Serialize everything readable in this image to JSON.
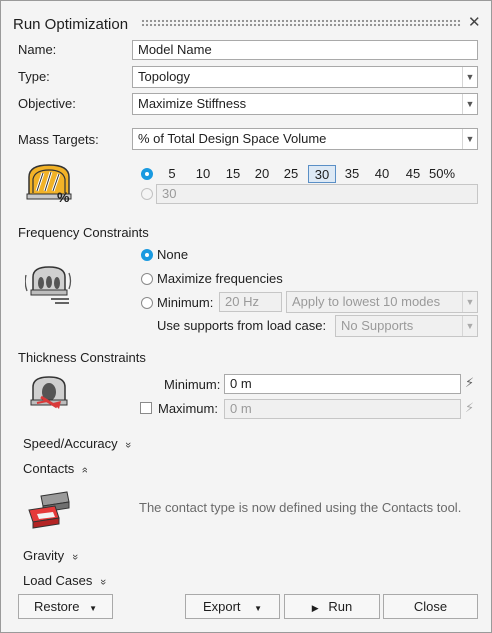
{
  "window": {
    "title": "Run Optimization",
    "close_glyph": "✕"
  },
  "fields": {
    "name_label": "Name:",
    "name_value": "Model Name",
    "type_label": "Type:",
    "type_value": "Topology",
    "objective_label": "Objective:",
    "objective_value": "Maximize Stiffness"
  },
  "mass": {
    "label": "Mass Targets:",
    "mode_value": "% of Total Design Space Volume",
    "percent_options": [
      "5",
      "10",
      "15",
      "20",
      "25",
      "30",
      "35",
      "40",
      "45",
      "50%"
    ],
    "selected_percent": "30",
    "custom_value": "30",
    "icon_pct": "%"
  },
  "frequency": {
    "section_title": "Frequency Constraints",
    "opt_none": "None",
    "opt_maximize": "Maximize frequencies",
    "opt_minimum": "Minimum:",
    "min_value": "20 Hz",
    "apply_value": "Apply to lowest 10 modes",
    "supports_label": "Use supports from load case:",
    "supports_value": "No Supports",
    "selected": "None"
  },
  "thickness": {
    "section_title": "Thickness Constraints",
    "min_label": "Minimum:",
    "min_value": "0 m",
    "max_label": "Maximum:",
    "max_value": "0 m",
    "max_checked": false
  },
  "sections": {
    "speed": "Speed/Accuracy",
    "contacts": "Contacts",
    "gravity": "Gravity",
    "loadcases": "Load Cases",
    "chevron_down": "»",
    "chevron_up": "»"
  },
  "contacts_note": "The contact type is now defined using the Contacts tool.",
  "buttons": {
    "restore": "Restore",
    "export": "Export",
    "run": "Run",
    "close": "Close"
  },
  "icons": {
    "dropdown": "arrow-down-icon",
    "bolt": "lightning-icon",
    "run": "play-icon"
  },
  "colors": {
    "accent": "#1a9ae0",
    "selected_bg": "#dde9f5",
    "window_bg": "#f4f4f4"
  }
}
